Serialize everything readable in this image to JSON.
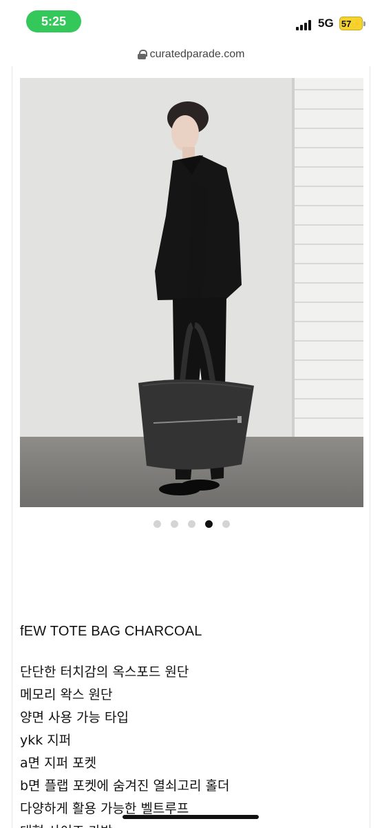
{
  "status_bar": {
    "time": "5:25",
    "network": "5G",
    "battery": "57",
    "time_pill_color": "#34c759",
    "battery_color": "#f5d32e"
  },
  "browser": {
    "url": "curatedparade.com",
    "lock_icon": "lock-icon"
  },
  "carousel": {
    "total_dots": 5,
    "active_index": 3
  },
  "product": {
    "title": "fEW TOTE BAG CHARCOAL",
    "features": [
      "단단한 터치감의 옥스포드 원단",
      "메모리 왁스 원단",
      "양면 사용 가능 타입",
      "ykk 지퍼",
      "a면 지퍼 포켓",
      "b면 플랩 포켓에 숨겨진 열쇠고리 홀더",
      "다양하게 활용 가능한 벨트루프",
      "대형 사이즈 가방"
    ]
  }
}
